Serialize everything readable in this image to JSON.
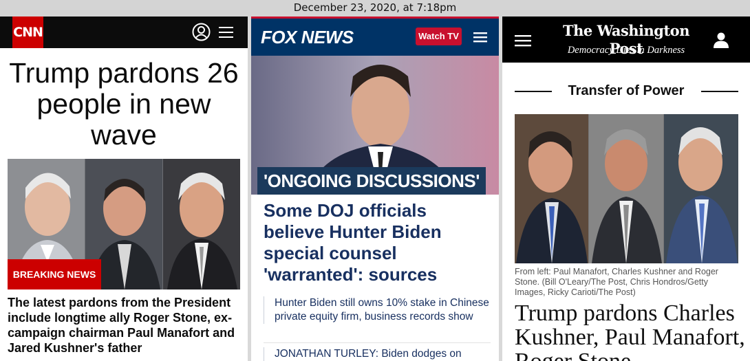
{
  "screen": {
    "date_label": "December 23, 2020, at 7:18pm"
  },
  "cnn": {
    "logo": "CNN",
    "headline": "Trump pardons 26 people in new wave",
    "badge": "BREAKING NEWS",
    "subhead": "The latest pardons from the President include longtime ally Roger Stone, ex-campaign chairman Paul Manafort and Jared Kushner's father",
    "colors": {
      "brand": "#cc0000",
      "header": "#0c0c0c"
    },
    "icons": [
      "user-circle-icon",
      "hamburger-menu-icon"
    ]
  },
  "fox": {
    "logo": "FOX NEWS",
    "watch_button": "Watch TV",
    "kicker": "'ONGOING DISCUSSIONS'",
    "headline": "Some DOJ officials believe Hunter Biden special counsel 'warranted': sources",
    "related": [
      "Hunter Biden still owns 10% stake in Chinese private equity firm, business records show",
      "JONATHAN TURLEY: Biden dodges on"
    ],
    "colors": {
      "header": "#003366",
      "accent": "#c8102e",
      "text": "#183060"
    },
    "icons": [
      "hamburger-menu-icon"
    ]
  },
  "wapo": {
    "logo": "The Washington Post",
    "tagline": "Democracy Dies in Darkness",
    "kicker": "Transfer of Power",
    "caption": "From left: Paul Manafort, Charles Kushner and Roger Stone. (Bill O'Leary/The Post, Chris Hondros/Getty Images, Ricky Carioti/The Post)",
    "headline": "Trump pardons Charles Kushner, Paul Manafort, Roger Stone",
    "colors": {
      "header": "#000000"
    },
    "icons": [
      "hamburger-menu-icon",
      "user-icon"
    ]
  }
}
